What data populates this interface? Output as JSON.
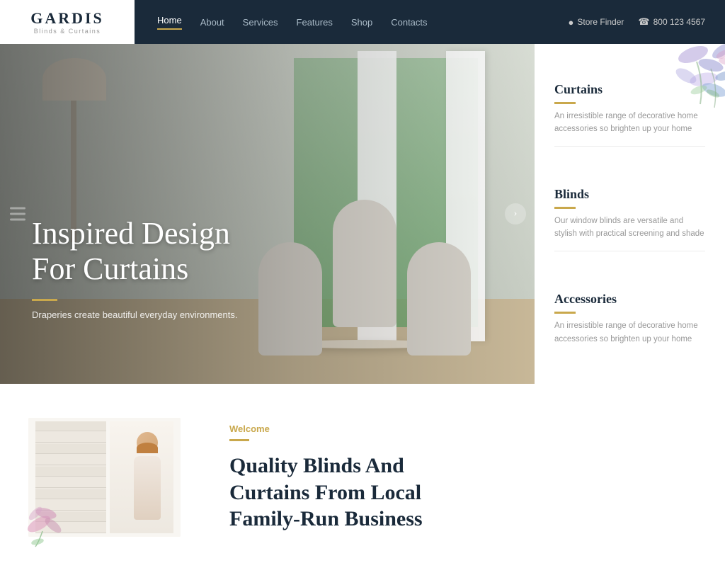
{
  "brand": {
    "name": "GARDIS",
    "tagline": "Blinds & Curtains"
  },
  "navbar": {
    "links": [
      {
        "label": "Home",
        "active": true
      },
      {
        "label": "About",
        "active": false
      },
      {
        "label": "Services",
        "active": false
      },
      {
        "label": "Features",
        "active": false
      },
      {
        "label": "Shop",
        "active": false
      },
      {
        "label": "Contacts",
        "active": false
      }
    ],
    "store_finder": "Store Finder",
    "phone": "800 123 4567"
  },
  "hero": {
    "heading_line1": "Inspired Design",
    "heading_line2": "For Curtains",
    "subtext": "Draperies create beautiful everyday environments."
  },
  "sidebar": {
    "items": [
      {
        "title": "Curtains",
        "description": "An irresistible range of decorative home accessories so brighten up your home"
      },
      {
        "title": "Blinds",
        "description": "Our window blinds are versatile and stylish with practical screening and shade"
      },
      {
        "title": "Accessories",
        "description": "An irresistible range of decorative home accessories so brighten up your home"
      }
    ]
  },
  "welcome_section": {
    "label": "Welcome",
    "heading": "Quality Blinds And Curtains From Local Family-Run Business"
  },
  "colors": {
    "accent": "#c9a84c",
    "dark_navy": "#1a2a3a",
    "text_muted": "#888888"
  }
}
